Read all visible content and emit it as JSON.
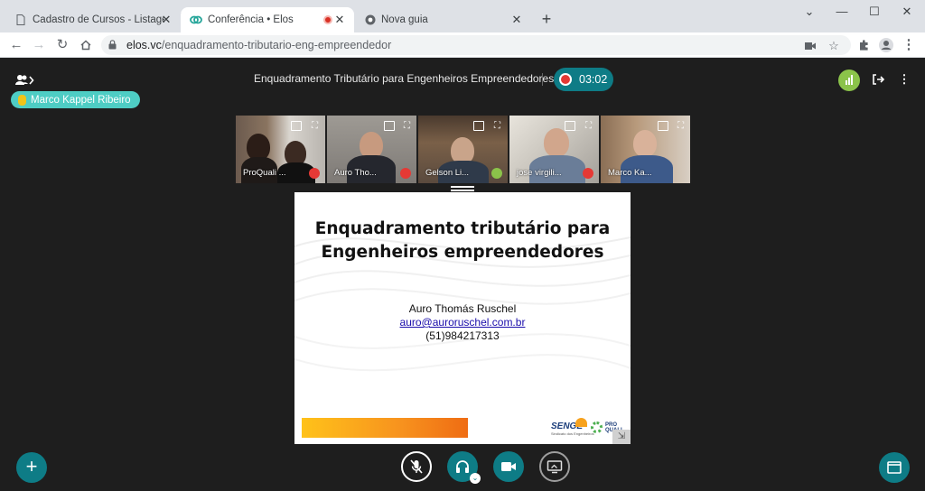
{
  "browser": {
    "tabs": [
      {
        "title": "Cadastro de Cursos - Listagem d",
        "active": false,
        "icon": "page-icon"
      },
      {
        "title": "Conferência • Elos",
        "active": true,
        "icon": "elos-logo-icon"
      },
      {
        "title": "Nova guia",
        "active": false,
        "icon": "chrome-icon"
      }
    ],
    "close_glyph": "✕",
    "new_tab_glyph": "+",
    "window_controls": {
      "minimize": "—",
      "maximize": "☐",
      "close": "✕"
    },
    "url_host": "elos.vc",
    "url_path": "/enquadramento-tributario-eng-empreendedor"
  },
  "conference": {
    "title": "Enquadramento Tributário para Engenheiros Empreendedores",
    "timer": "03:02",
    "active_speaker": "Marco Kappel Ribeiro",
    "accent": "#0e7c86",
    "participants": [
      {
        "name": "ProQuali ...",
        "status": "muted"
      },
      {
        "name": "Auro Tho...",
        "status": "muted"
      },
      {
        "name": "Gelson Li...",
        "status": "speaking"
      },
      {
        "name": "jose virgili...",
        "status": "muted"
      },
      {
        "name": "Marco Ka...",
        "status": "speaking"
      }
    ]
  },
  "slide": {
    "title_line1": "Enquadramento tributário para",
    "title_line2": "Engenheiros empreendedores",
    "author": "Auro Thomás Ruschel",
    "email": "auro@auroruschel.com.br",
    "phone": "(51)984217313",
    "logo_senge": "SENGE",
    "logo_senge_sub": "Sindicato dos Engenheiros",
    "logo_proquali": "PRO QUALI"
  }
}
